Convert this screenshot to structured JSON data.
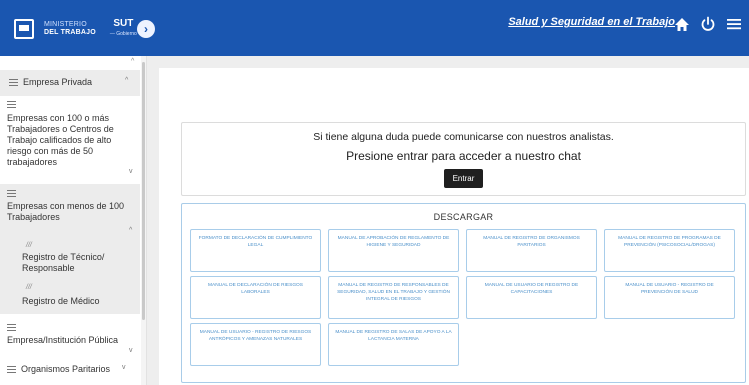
{
  "header": {
    "ministry_line1": "MINISTERIO",
    "ministry_line2": "DEL TRABAJO",
    "sut": "SUT",
    "sut_sub": "— Gobierno",
    "site_title": "Salud y Seguridad en el Trabajo",
    "icons": [
      "home-icon",
      "power-icon",
      "menu-icon"
    ]
  },
  "sidebar": {
    "empresa_privada": "Empresa Privada",
    "empresas_100": "Empresas con 100 o más Trabajadores o Centros de Trabajo calificados de alto riesgo con más de 50 trabajadores",
    "empresas_menos_100": "Empresas con menos de 100 Trabajadores",
    "registro_tecnico": "Registro de Técnico/ Responsable",
    "registro_medico": "Registro de Médico",
    "empresa_publica": "Empresa/Institución Pública",
    "organismos_paritarios": "Organismos Paritarios"
  },
  "contact": {
    "line1": "Si tiene alguna duda puede comunicarse con nuestros analistas.",
    "line2": "Presione entrar para acceder a nuestro chat",
    "enter_label": "Entrar"
  },
  "downloads": {
    "title": "DESCARGAR",
    "items": [
      "FORMATO DE DECLARACIÓN DE CUMPLIMIENTO LEGAL",
      "MANUAL DE APROBACIÓN DE REGLAMENTO DE HIGIENE Y SEGURIDAD",
      "MANUAL DE REGISTRO DE ORGANISMOS PARITARIOS",
      "MANUAL DE REGISTRO DE PROGRAMAS DE PREVENCIÓN (PSICOSOCIAL/DROGAS)",
      "MANUAL DE DECLARACIÓN DE RIESGOS LABORALES",
      "MANUAL DE REGISTRO DE RESPONSABLES DE SEGURIDAD, SALUD EN EL TRABAJO Y GESTIÓN INTEGRAL DE RIESGOS",
      "MANUAL DE USUARIO DE REGISTRO DE CAPACITACIONES",
      "MANUAL DE USUARIO - REGISTRO DE PREVENCIÓN DE SALUD",
      "MANUAL DE USUARIO - REGISTRO DE RIESGOS ANTRÓPICOS Y AMENAZAS NATURALES",
      "MANUAL DE REGISTRO DE SALAS DE APOYO A LA LACTANCIA MATERNA"
    ]
  },
  "colors": {
    "header_bg": "#1a56b0",
    "card_border": "#a8cdea",
    "card_text": "#4a8fc9",
    "button_bg": "#1f1f1f"
  }
}
